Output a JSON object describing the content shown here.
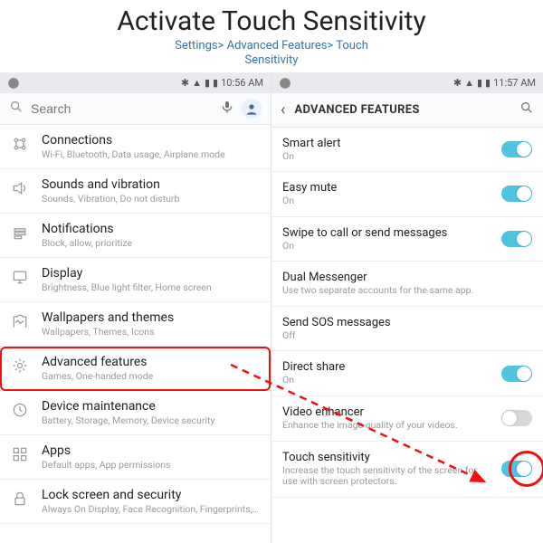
{
  "header": {
    "title": "Activate Touch Sensitivity",
    "breadcrumb_line1": "Settings> Advanced Features> Touch",
    "breadcrumb_line2": "Sensitivity"
  },
  "left": {
    "status": {
      "left_icon": "reddit",
      "time": "10:56 AM"
    },
    "search": {
      "placeholder": "Search",
      "mic_icon": "mic",
      "avatar": "avatar"
    },
    "items": [
      {
        "icon": "connections",
        "title": "Connections",
        "sub": "Wi-Fi, Bluetooth, Data usage, Airplane mode"
      },
      {
        "icon": "sound",
        "title": "Sounds and vibration",
        "sub": "Sounds, Vibration, Do not disturb"
      },
      {
        "icon": "notifications",
        "title": "Notifications",
        "sub": "Block, allow, prioritize"
      },
      {
        "icon": "display",
        "title": "Display",
        "sub": "Brightness, Blue light filter, Home screen"
      },
      {
        "icon": "wallpapers",
        "title": "Wallpapers and themes",
        "sub": "Wallpapers, Themes, Icons"
      },
      {
        "icon": "advanced",
        "title": "Advanced features",
        "sub": "Games, One-handed mode",
        "highlight": true
      },
      {
        "icon": "maintenance",
        "title": "Device maintenance",
        "sub": "Battery, Storage, Memory, Device security"
      },
      {
        "icon": "apps",
        "title": "Apps",
        "sub": "Default apps, App permissions"
      },
      {
        "icon": "lock",
        "title": "Lock screen and security",
        "sub": "Always On Display, Face Recognition, Fingerprints, Iris"
      }
    ]
  },
  "right": {
    "status": {
      "left_icon": "reddit",
      "time": "11:57 AM"
    },
    "header": {
      "label": "ADVANCED FEATURES"
    },
    "items": [
      {
        "title": "Smart alert",
        "sub": "On",
        "toggle": "on"
      },
      {
        "title": "Easy mute",
        "sub": "On",
        "toggle": "on"
      },
      {
        "title": "Swipe to call or send messages",
        "sub": "On",
        "toggle": "on"
      },
      {
        "title": "Dual Messenger",
        "sub": "Use two separate accounts for the same app.",
        "toggle": null
      },
      {
        "title": "Send SOS messages",
        "sub": "Off",
        "toggle": null
      },
      {
        "title": "Direct share",
        "sub": "On",
        "toggle": "on"
      },
      {
        "title": "Video enhancer",
        "sub": "Enhance the image quality of your videos.",
        "toggle": "off"
      },
      {
        "title": "Touch sensitivity",
        "sub": "Increase the touch sensitivity of the screen for use with screen protectors.",
        "toggle": "on",
        "circle": true
      }
    ]
  }
}
